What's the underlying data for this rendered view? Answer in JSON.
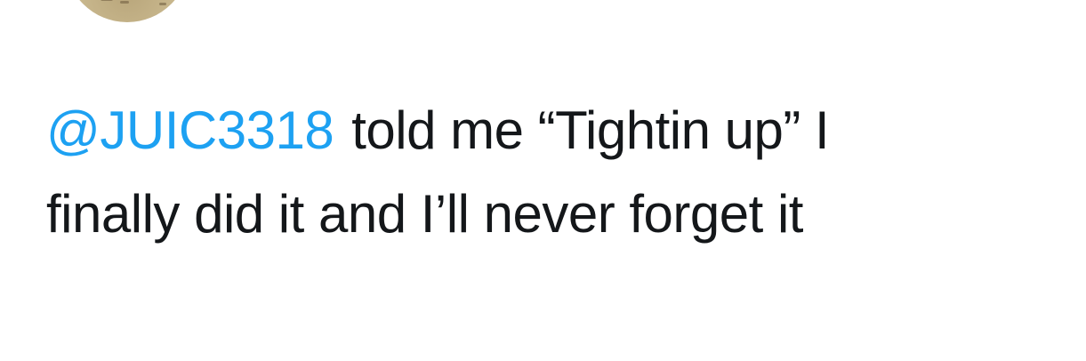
{
  "tweet": {
    "mention": "@JUIC3318",
    "text_line1": "told me “Tightin up” I",
    "text_line2": "finally did it and I’ll never forget it"
  },
  "colors": {
    "mention": "#1da1f2",
    "text": "#14171a",
    "background": "#ffffff"
  },
  "icons": {
    "avatar": "profile-avatar"
  }
}
